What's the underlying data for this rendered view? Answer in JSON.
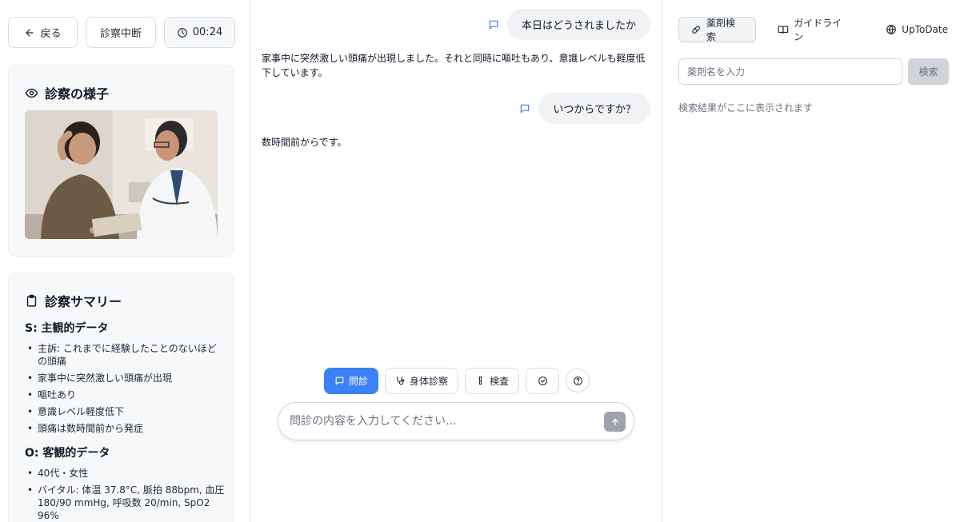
{
  "top_buttons": {
    "back_label": "戻る",
    "stop_label": "診察中断",
    "timer": "00:24"
  },
  "scene_card": {
    "title": "診察の様子",
    "image_alt": "patient with headache and doctor"
  },
  "summary_card": {
    "title": "診察サマリー",
    "subjective": {
      "heading": "S: 主観的データ",
      "items": [
        "主訴: これまでに経験したことのないほどの頭痛",
        "家事中に突然激しい頭痛が出現",
        "嘔吐あり",
        "意識レベル軽度低下",
        "頭痛は数時間前から発症"
      ]
    },
    "objective": {
      "heading": "O: 客観的データ",
      "items": [
        "40代・女性",
        "バイタル: 体温 37.8°C, 脈拍 88bpm, 血圧 180/90 mmHg, 呼吸数 20/min, SpO2 96%"
      ]
    }
  },
  "chat": {
    "messages": [
      {
        "role": "doctor",
        "text": "本日はどうされましたか"
      },
      {
        "role": "patient",
        "text": "家事中に突然激しい頭痛が出現しました。それと同時に嘔吐もあり、意識レベルも軽度低下しています。"
      },
      {
        "role": "doctor",
        "text": "いつからですか？"
      },
      {
        "role": "patient",
        "text": "数時間前からです。"
      }
    ],
    "modes": {
      "interview": "問診",
      "physical": "身体診察",
      "test": "検査"
    },
    "input_placeholder": "問診の内容を入力してください..."
  },
  "right_panel": {
    "tabs": {
      "drug": "薬剤検索",
      "guideline": "ガイドライン",
      "uptodate": "UpToDate"
    },
    "search_placeholder": "薬剤名を入力",
    "search_button": "検索",
    "result_hint": "検索結果がここに表示されます"
  },
  "colors": {
    "accent": "#3b82f6",
    "card_bg": "#f7f8fa",
    "bubble_bg": "#f1f2f4"
  },
  "icons": [
    "arrow-left-icon",
    "clock-icon",
    "eye-icon",
    "clipboard-icon",
    "message-icon",
    "stethoscope-icon",
    "test-tube-icon",
    "check-circle-icon",
    "help-circle-icon",
    "arrow-up-icon",
    "pill-icon",
    "book-icon",
    "globe-icon"
  ]
}
